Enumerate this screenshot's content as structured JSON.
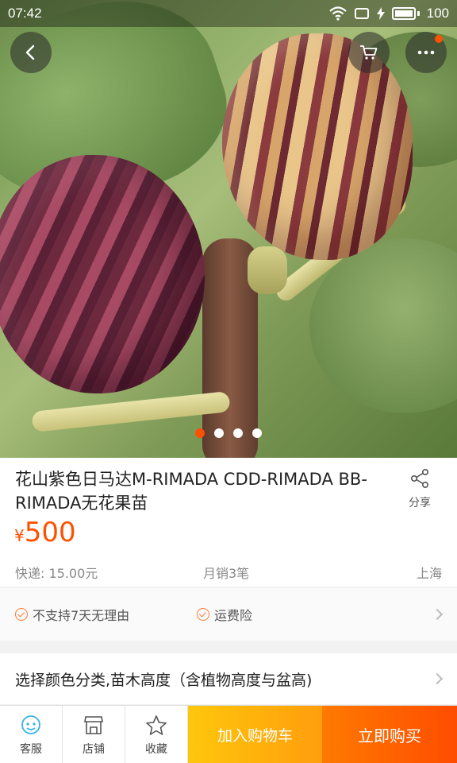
{
  "status_bar": {
    "time": "07:42",
    "battery": "100"
  },
  "hero": {
    "pager": {
      "total": 4,
      "active_index": 0
    }
  },
  "product": {
    "title": "花山紫色日马达M-RIMADA CDD-RIMADA BB-RIMADA无花果苗",
    "share_label": "分享",
    "price_symbol": "¥",
    "price": "500",
    "shipping": "快递: 15.00元",
    "monthly_sales": "月销3笔",
    "location": "上海"
  },
  "services": [
    {
      "label": "不支持7天无理由"
    },
    {
      "label": "运费险"
    }
  ],
  "sku_selector": {
    "label": "选择颜色分类,苗木高度（含植物高度与盆高)"
  },
  "bottom_bar": {
    "customer_service": "客服",
    "shop": "店铺",
    "favorite": "收藏",
    "add_to_cart": "加入购物车",
    "buy_now": "立即购买"
  },
  "colors": {
    "accent": "#ff5000",
    "cart_button": "#ffb400",
    "buy_button": "#ff5a00"
  },
  "icons": [
    "back-icon",
    "cart-icon",
    "more-icon",
    "share-icon",
    "service-icon",
    "shop-icon",
    "star-icon",
    "check-icon",
    "chevron-right-icon"
  ]
}
